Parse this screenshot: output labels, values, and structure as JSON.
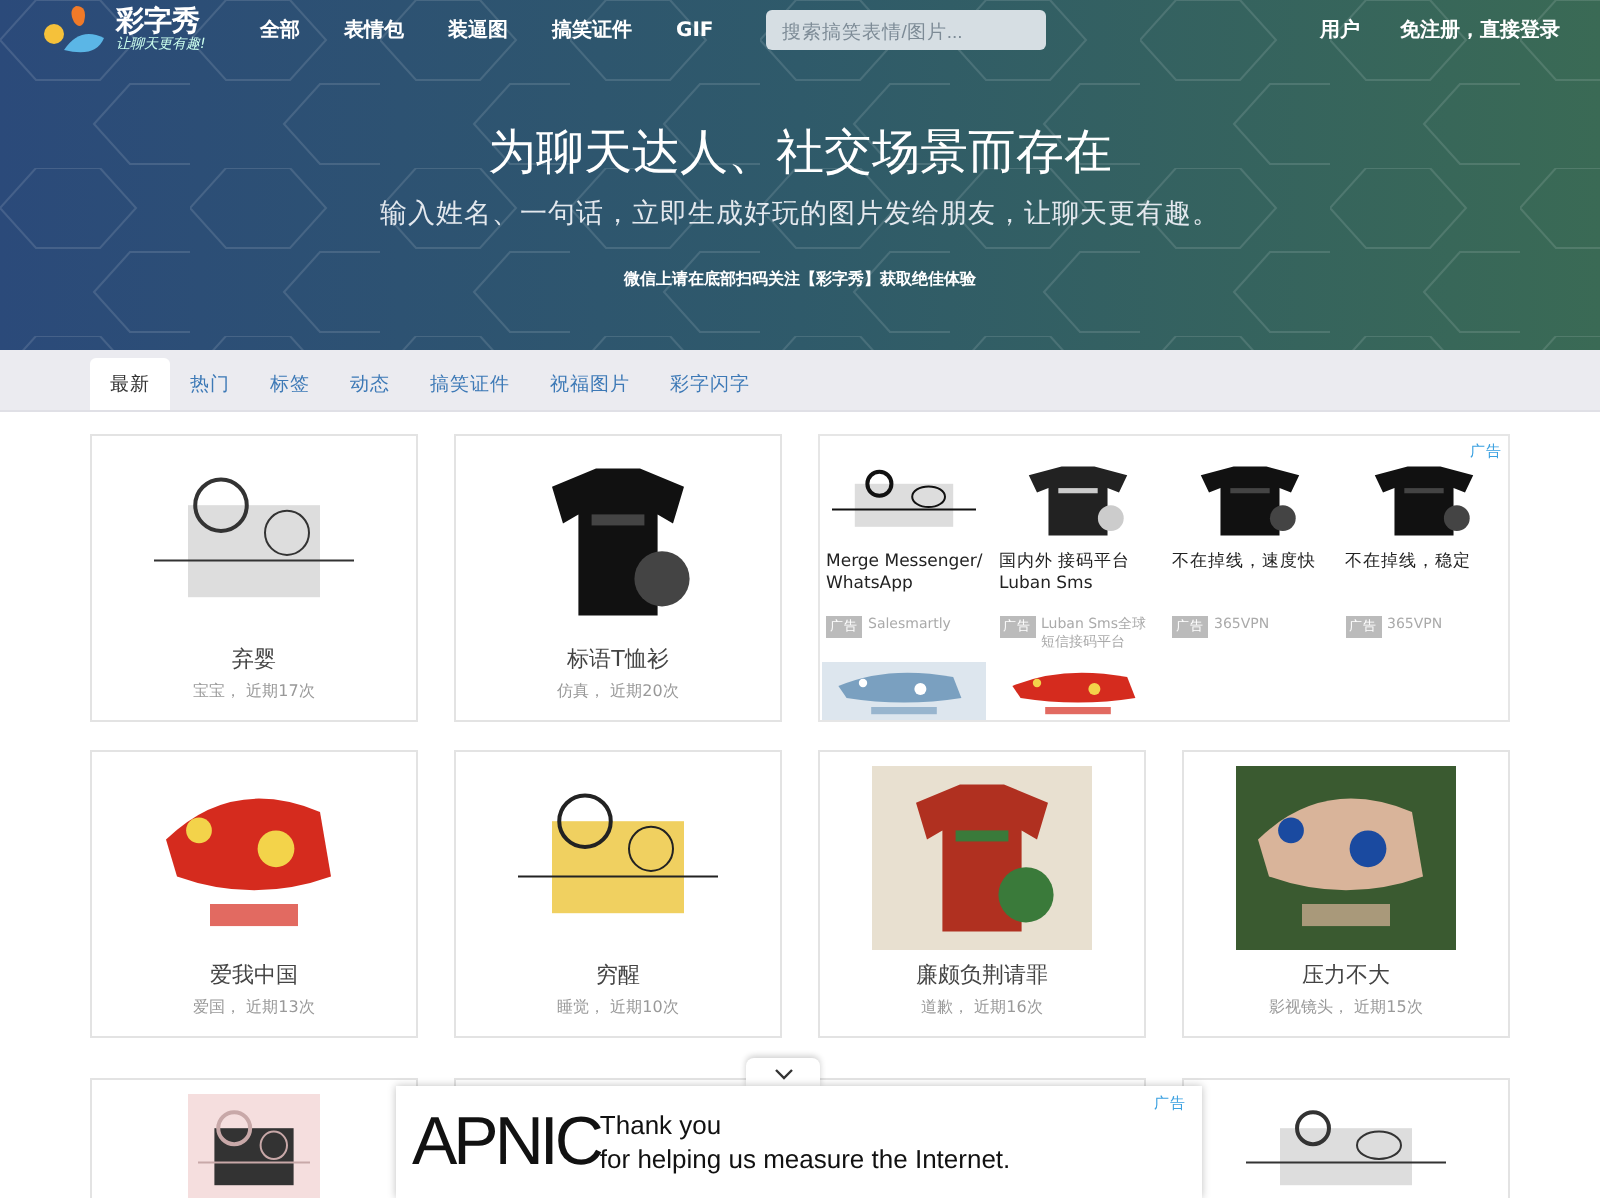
{
  "header": {
    "logo": {
      "name": "彩字秀",
      "slogan": "让聊天更有趣!"
    },
    "nav": [
      {
        "label": "全部"
      },
      {
        "label": "表情包"
      },
      {
        "label": "装逼图"
      },
      {
        "label": "搞笑证件"
      },
      {
        "label": "GIF"
      }
    ],
    "search": {
      "placeholder": "搜索搞笑表情/图片..."
    },
    "user_links": [
      {
        "label": "用户"
      },
      {
        "label": "免注册，直接登录"
      }
    ]
  },
  "hero": {
    "title": "为聊天达人、社交场景而存在",
    "subtitle": "输入姓名、一句话，立即生成好玩的图片发给朋友，让聊天更有趣。",
    "note": "微信上请在底部扫码关注【彩字秀】获取绝佳体验"
  },
  "tabs": [
    {
      "label": "最新",
      "selected": true
    },
    {
      "label": "热门",
      "selected": false
    },
    {
      "label": "标签",
      "selected": false
    },
    {
      "label": "动态",
      "selected": false
    },
    {
      "label": "搞笑证件",
      "selected": false
    },
    {
      "label": "祝福图片",
      "selected": false
    },
    {
      "label": "彩字闪字",
      "selected": false
    }
  ],
  "row_1": [
    {
      "title": "弃婴",
      "meta": "宝宝， 近期17次"
    },
    {
      "title": "标语T恤衫",
      "meta": "仿真， 近期20次"
    }
  ],
  "ad_panel": {
    "label": "广告",
    "items": [
      {
        "title": "Merge Messenger/ WhatsApp",
        "badge": "广告",
        "source": "Salesmartly"
      },
      {
        "title": "国内外 接码平台 Luban Sms",
        "badge": "广告",
        "source": "Luban Sms全球短信接码平台"
      },
      {
        "title": "不在掉线，速度快",
        "badge": "广告",
        "source": "365VPN"
      },
      {
        "title": "不在掉线，稳定",
        "badge": "广告",
        "source": "365VPN"
      }
    ]
  },
  "row_2": [
    {
      "title": "爱我中国",
      "meta": "爱国， 近期13次"
    },
    {
      "title": "穷醒",
      "meta": "睡觉， 近期10次"
    },
    {
      "title": "廉颇负荆请罪",
      "meta": "道歉， 近期16次"
    },
    {
      "title": "压力不大",
      "meta": "影视镜头， 近期15次"
    }
  ],
  "bottom_ad": {
    "logo": "APNIC",
    "line_1": "Thank you",
    "line_2": "for helping us measure the Internet.",
    "label": "广告"
  }
}
